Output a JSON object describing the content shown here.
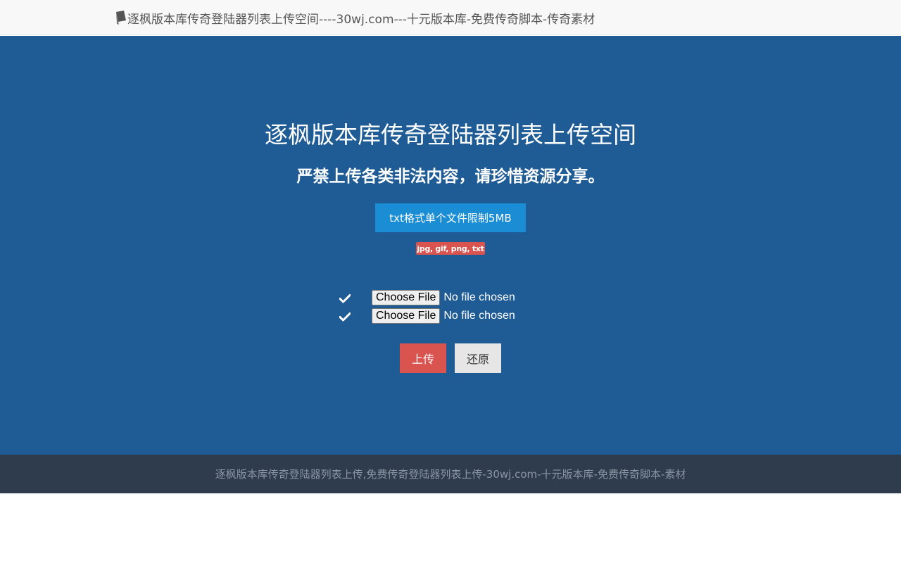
{
  "navbar": {
    "brand_icon": "book-icon",
    "brand_text": "逐枫版本库传奇登陆器列表上传空间----30wj.com---十元版本库-免费传奇脚本-传奇素材"
  },
  "hero": {
    "title": "逐枫版本库传奇登陆器列表上传空间",
    "subtitle": "严禁上传各类非法内容，请珍惜资源分享。",
    "limit_label": "txt格式单个文件限制5MB",
    "formats_label": "jpg, gif, png, txt"
  },
  "uploads": [
    {
      "icon": "check-icon",
      "button_label": "Choose File",
      "status": "No file chosen"
    },
    {
      "icon": "check-icon",
      "button_label": "Choose File",
      "status": "No file chosen"
    }
  ],
  "actions": {
    "submit_label": "上传",
    "reset_label": "还原"
  },
  "footer": {
    "text": "逐枫版本库传奇登陆器列表上传,免费传奇登陆器列表上传-30wj.com-十元版本库-免费传奇脚本-素材"
  },
  "colors": {
    "hero_bg": "#1f5c96",
    "limit_button": "#1a8dd4",
    "danger": "#d9534f",
    "footer_bg": "#2e3c4d"
  }
}
